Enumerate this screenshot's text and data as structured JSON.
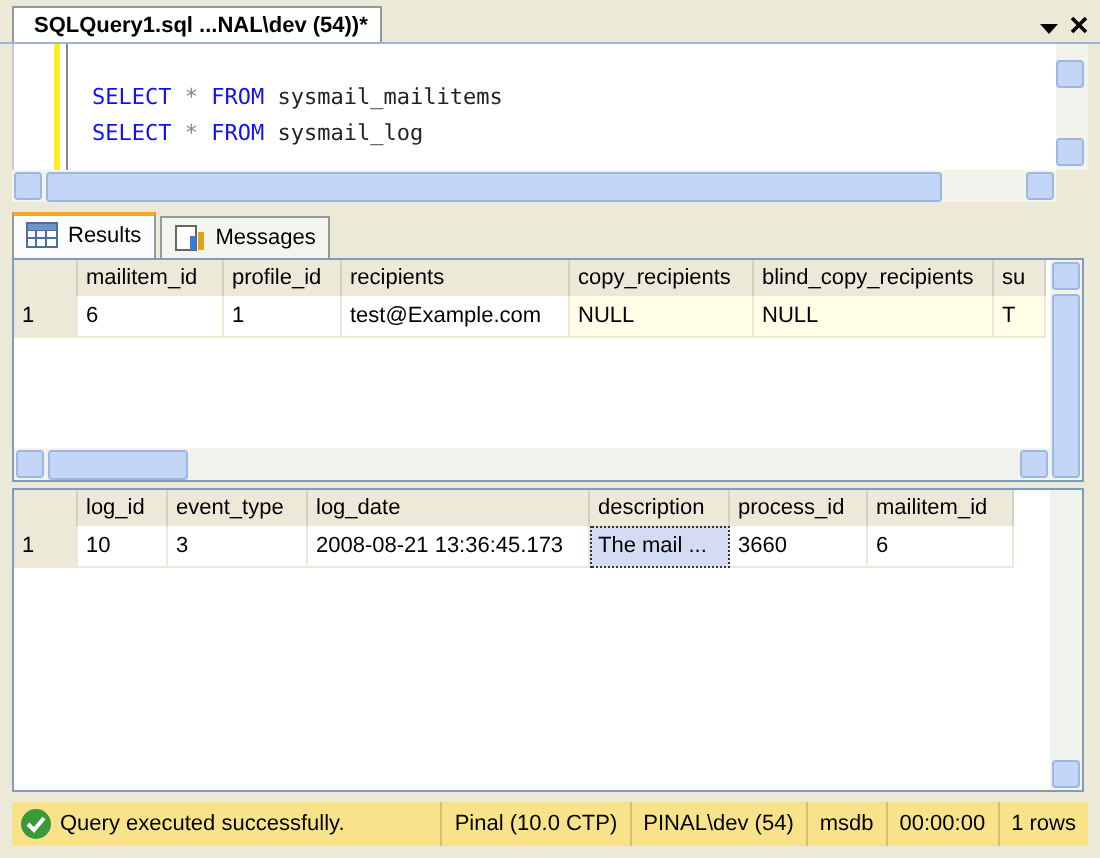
{
  "document_tab": {
    "title": "SQLQuery1.sql ...NAL\\dev (54))*"
  },
  "editor": {
    "lines": [
      [
        {
          "kind": "keyword",
          "text": "SELECT"
        },
        {
          "kind": "operator",
          "text": "*"
        },
        {
          "kind": "keyword",
          "text": "FROM"
        },
        {
          "kind": "identifier",
          "text": "sysmail_mailitems"
        }
      ],
      [
        {
          "kind": "keyword",
          "text": "SELECT"
        },
        {
          "kind": "operator",
          "text": "*"
        },
        {
          "kind": "keyword",
          "text": "FROM"
        },
        {
          "kind": "identifier",
          "text": "sysmail_log"
        }
      ]
    ]
  },
  "result_tabs": [
    {
      "label": "Results",
      "selected": true
    },
    {
      "label": "Messages",
      "selected": false
    }
  ],
  "grids": [
    {
      "columns": [
        "mailitem_id",
        "profile_id",
        "recipients",
        "copy_recipients",
        "blind_copy_recipients",
        "su"
      ],
      "rows": [
        {
          "row_number": "1",
          "cells": [
            {
              "text": "6",
              "kind": "value",
              "selected": false
            },
            {
              "text": "1",
              "kind": "value",
              "selected": false
            },
            {
              "text": "test@Example.com",
              "kind": "value",
              "selected": false
            },
            {
              "text": "NULL",
              "kind": "null",
              "selected": false
            },
            {
              "text": "NULL",
              "kind": "null",
              "selected": false
            },
            {
              "text": "T",
              "kind": "null",
              "selected": false
            }
          ]
        }
      ]
    },
    {
      "columns": [
        "log_id",
        "event_type",
        "log_date",
        "description",
        "process_id",
        "mailitem_id"
      ],
      "rows": [
        {
          "row_number": "1",
          "cells": [
            {
              "text": "10",
              "kind": "value",
              "selected": false
            },
            {
              "text": "3",
              "kind": "value",
              "selected": false
            },
            {
              "text": "2008-08-21 13:36:45.173",
              "kind": "value",
              "selected": false
            },
            {
              "text": "The mail ...",
              "kind": "value",
              "selected": true
            },
            {
              "text": "3660",
              "kind": "value",
              "selected": false
            },
            {
              "text": "6",
              "kind": "value",
              "selected": false
            }
          ]
        }
      ]
    }
  ],
  "status_bar": {
    "message": "Query executed successfully.",
    "server": "Pinal (10.0 CTP)",
    "login": "PINAL\\dev (54)",
    "database": "msdb",
    "elapsed": "00:00:00",
    "row_count": "1 rows"
  }
}
